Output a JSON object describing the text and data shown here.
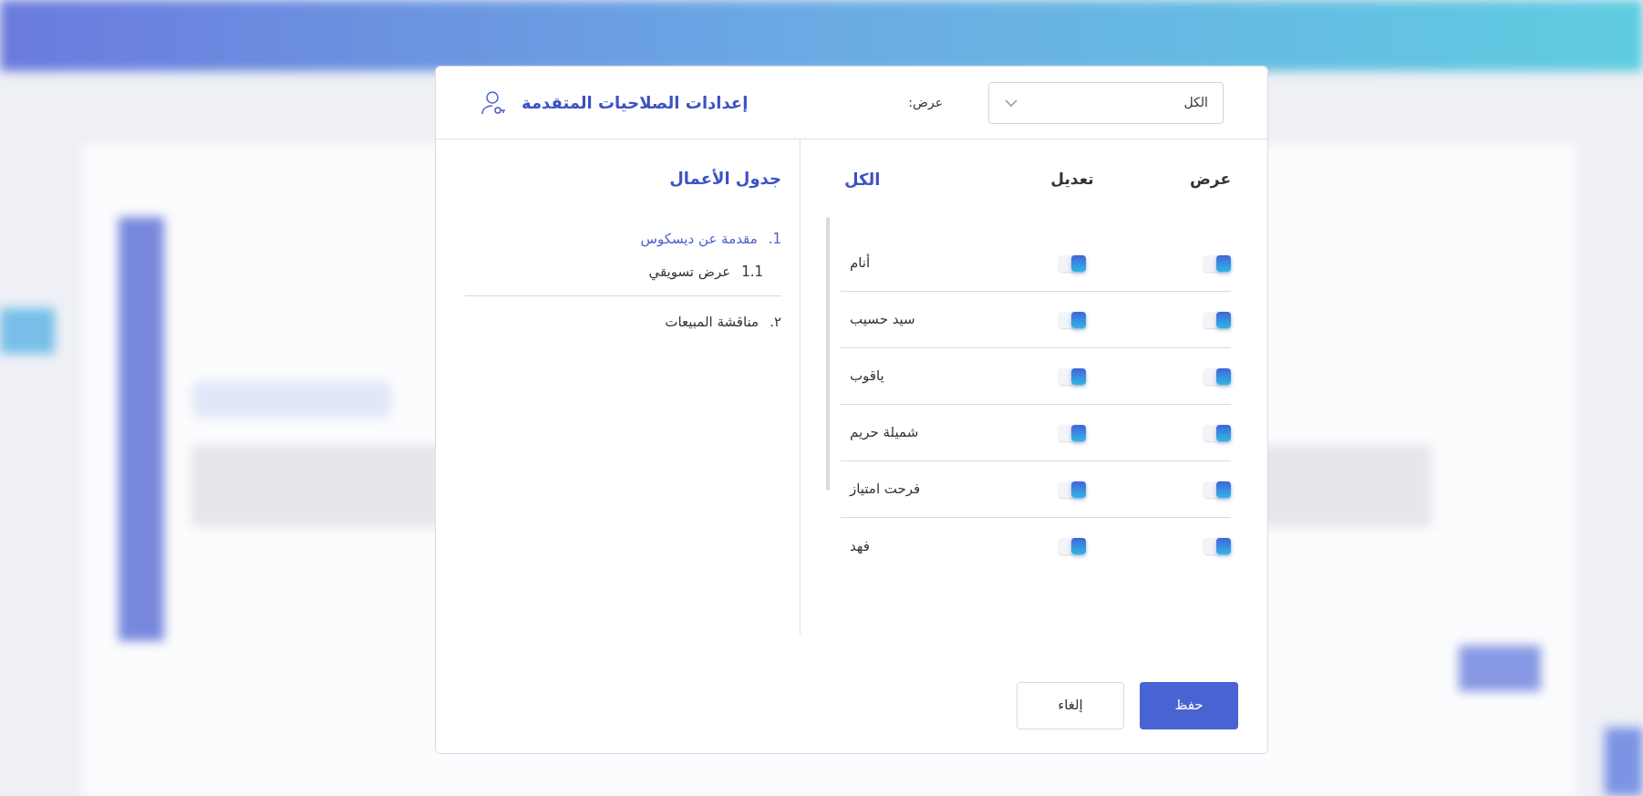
{
  "dialog": {
    "title": "إعدادات الصلاحيات المتقدمة",
    "filter": {
      "label": "عرض:",
      "value": "الكل"
    }
  },
  "permissions": {
    "columns": [
      "عرض",
      "تعديل"
    ],
    "heading": "الكل",
    "rows": [
      {
        "name": "أنام",
        "view": true,
        "edit": true
      },
      {
        "name": "سيد حسيب",
        "view": true,
        "edit": true
      },
      {
        "name": "ياقوب",
        "view": true,
        "edit": true
      },
      {
        "name": "شميلة حريم",
        "view": true,
        "edit": true
      },
      {
        "name": "فرحت امتياز",
        "view": true,
        "edit": true
      },
      {
        "name": "فهد",
        "view": true,
        "edit": true
      }
    ]
  },
  "agenda": {
    "title": "جدول الأعمال",
    "items": [
      {
        "number": "1.",
        "label": "مقدمة عن ديسكوس",
        "selected": true,
        "children": [
          {
            "number": "1.1",
            "label": "عرض تسويقي",
            "selected": false
          }
        ]
      },
      {
        "number": "٢.",
        "label": "مناقشة المبيعات",
        "selected": false
      }
    ]
  },
  "buttons": [
    {
      "label": "حفظ",
      "kind": "primary"
    },
    {
      "label": "إلغاء",
      "kind": "secondary"
    }
  ]
}
